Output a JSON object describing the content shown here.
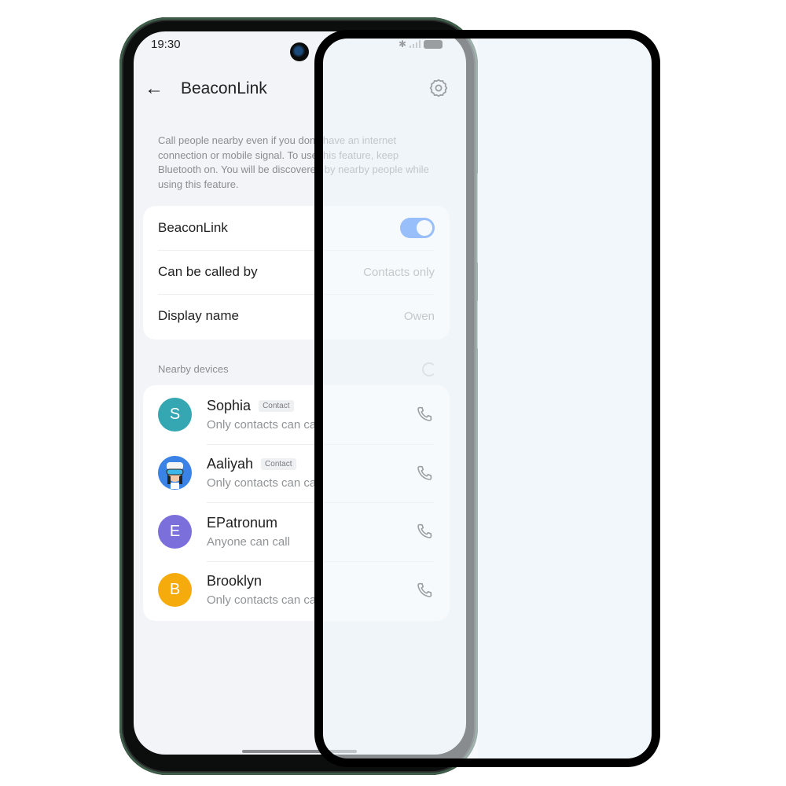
{
  "status_bar": {
    "time": "19:30",
    "icons": [
      "bluetooth-icon",
      "signal-icon",
      "battery-icon"
    ]
  },
  "header": {
    "title": "BeaconLink",
    "back_icon": "arrow-left-icon",
    "settings_icon": "gear-icon"
  },
  "description": "Call people nearby even if you don't have an internet connection or mobile signal. To use this feature, keep Bluetooth on. You will be discovered by nearby people while using this feature.",
  "settings": {
    "beaconlink": {
      "label": "BeaconLink",
      "enabled": true
    },
    "called_by": {
      "label": "Can be called by",
      "value": "Contacts only"
    },
    "display_name": {
      "label": "Display name",
      "value": "Owen"
    }
  },
  "nearby": {
    "section_label": "Nearby devices",
    "devices": [
      {
        "initial": "S",
        "name": "Sophia",
        "badge": "Contact",
        "subtitle": "Only contacts can call",
        "color": "#35a7b3"
      },
      {
        "initial": "",
        "name": "Aaliyah",
        "badge": "Contact",
        "subtitle": "Only contacts can call",
        "color": "#3b82e6"
      },
      {
        "initial": "E",
        "name": "EPatronum",
        "badge": "",
        "subtitle": "Anyone can call",
        "color": "#7b6fdc"
      },
      {
        "initial": "B",
        "name": "Brooklyn",
        "badge": "",
        "subtitle": "Only contacts can call",
        "color": "#f6ab0c"
      }
    ]
  },
  "colors": {
    "accent": "#2f7cf6",
    "phone_frame": "#3f5e49"
  }
}
